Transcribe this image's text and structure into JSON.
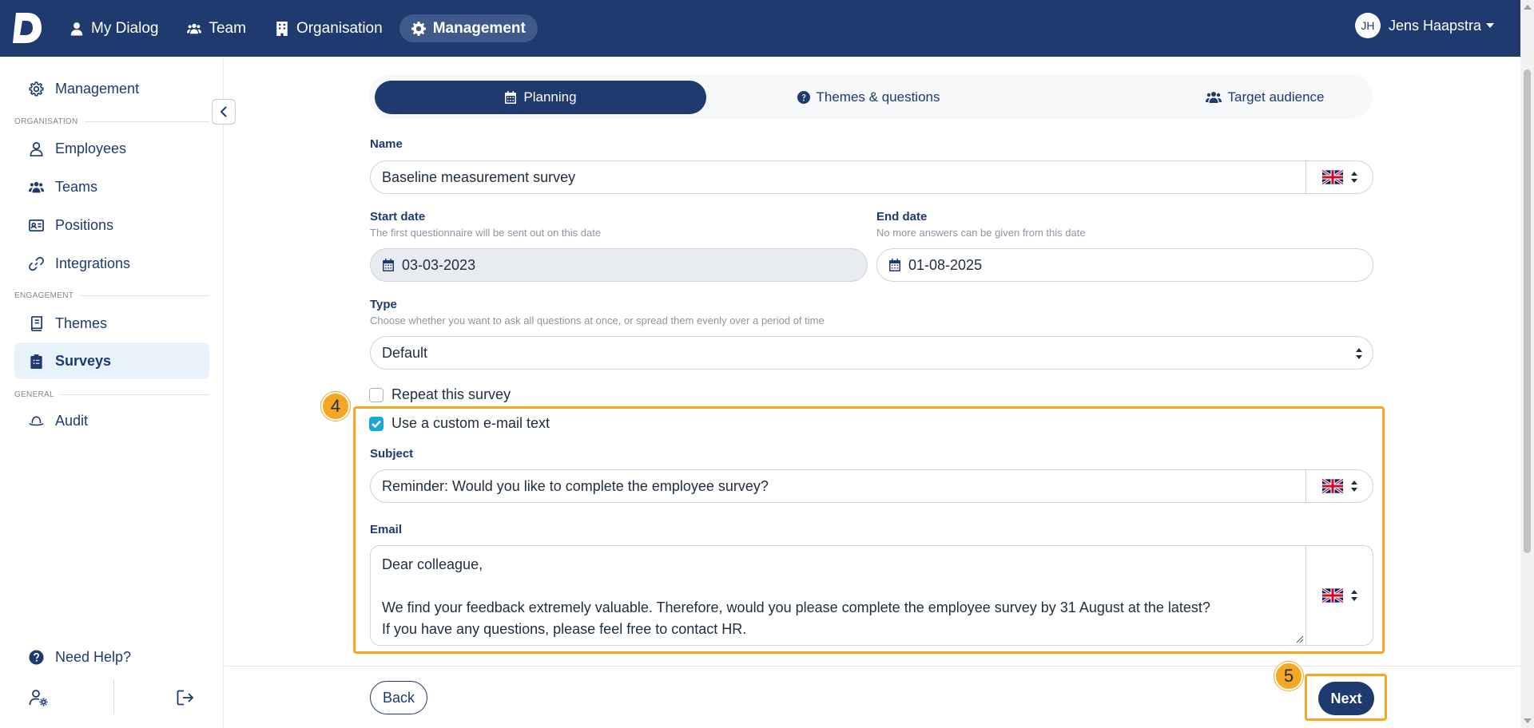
{
  "topbar": {
    "logo": "D",
    "nav": [
      {
        "label": "My Dialog",
        "icon": "user-icon"
      },
      {
        "label": "Team",
        "icon": "users-icon"
      },
      {
        "label": "Organisation",
        "icon": "building-icon"
      },
      {
        "label": "Management",
        "icon": "gear-icon",
        "active": true
      }
    ],
    "user": {
      "initials": "JH",
      "name": "Jens Haapstra"
    }
  },
  "sidebar": {
    "management": "Management",
    "section_organisation": "ORGANISATION",
    "employees": "Employees",
    "teams": "Teams",
    "positions": "Positions",
    "integrations": "Integrations",
    "section_engagement": "ENGAGEMENT",
    "themes": "Themes",
    "surveys": "Surveys",
    "section_general": "GENERAL",
    "audit": "Audit",
    "need_help": "Need Help?"
  },
  "tabs": {
    "planning": "Planning",
    "themes": "Themes & questions",
    "audience": "Target audience"
  },
  "form": {
    "name_label": "Name",
    "name_value": "Baseline measurement survey",
    "start_label": "Start date",
    "start_help": "The first questionnaire will be sent out on this date",
    "start_value": "03-03-2023",
    "end_label": "End date",
    "end_help": "No more answers can be given from this date",
    "end_value": "01-08-2025",
    "type_label": "Type",
    "type_help": "Choose whether you want to ask all questions at once, or spread them evenly over a period of time",
    "type_value": "Default",
    "repeat_label": "Repeat this survey",
    "custom_email_label": "Use a custom e-mail text",
    "subject_label": "Subject",
    "subject_value": "Reminder: Would you like to complete the employee survey?",
    "email_label": "Email",
    "email_line1": "Dear colleague,",
    "email_line2": "We find your feedback extremely valuable. Therefore, would you please complete the employee survey by 31 August at the latest?",
    "email_line3": "If you have any questions, please feel free to contact HR."
  },
  "steps": {
    "four": "4",
    "five": "5"
  },
  "buttons": {
    "back": "Back",
    "next": "Next"
  },
  "colors": {
    "primary": "#1e3a6e",
    "highlight": "#f5a623",
    "checkbox": "#19a7d8"
  }
}
